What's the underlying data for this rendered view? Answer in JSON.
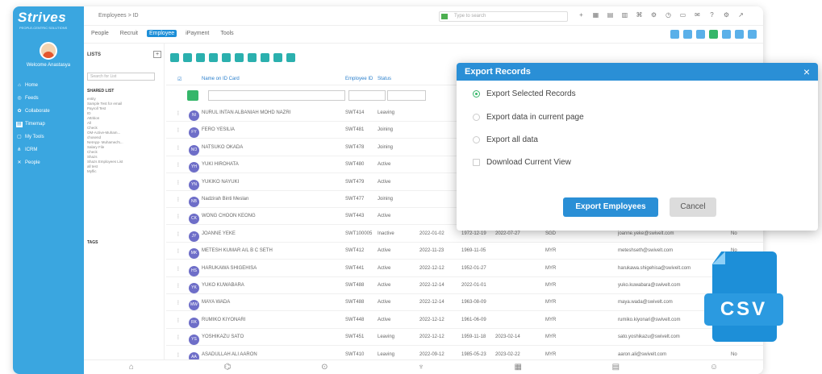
{
  "app": {
    "logo": "Strives",
    "tagline": "PEOPLE-CENTRIC SOLUTIONS",
    "breadcrumb": "Employees > ID",
    "welcome": "Welcome Anastasya"
  },
  "search": {
    "placeholder": "Type to search"
  },
  "nav": [
    {
      "label": "Home",
      "icon": "home-icon"
    },
    {
      "label": "Feeds",
      "icon": "feeds-icon"
    },
    {
      "label": "Collaborate",
      "icon": "collaborate-icon"
    },
    {
      "label": "Timemap",
      "icon": "timemap-icon"
    },
    {
      "label": "My Tools",
      "icon": "tools-icon"
    },
    {
      "label": "ICRM",
      "icon": "crm-icon"
    },
    {
      "label": "People",
      "icon": "people-icon"
    }
  ],
  "menu": [
    "People",
    "Recruit",
    "Employee",
    "iPayment",
    "Tools"
  ],
  "lists": {
    "title": "LISTS",
    "search_placeholder": "Search for List",
    "shared": "SHARED LIST",
    "tags": "TAGS",
    "items": [
      "entity",
      "Sample Test for email",
      "Payroll Test",
      "ID",
      "Attrition",
      "All",
      "Check",
      "OM-Active-Muham...",
      "chosend",
      "NetApp- Muhamed's...",
      "Salary File",
      "Check",
      "Shazs",
      "Shazs Employees List",
      "all test",
      "Myflic"
    ]
  },
  "grid": {
    "headers": [
      "Name on ID Card",
      "Employee ID",
      "Status"
    ],
    "rows": [
      {
        "initials": "NI",
        "name": "NURUL INTAN ALBANIAH MOHD NAZRI",
        "id": "SWT414",
        "status": "Leaving",
        "d1": "",
        "d2": "",
        "d3": "",
        "cc": "",
        "email": "",
        "x": ""
      },
      {
        "initials": "FY",
        "name": "FERO YESILIA",
        "id": "SWT481",
        "status": "Joining",
        "d1": "",
        "d2": "",
        "d3": "",
        "cc": "",
        "email": "",
        "x": ""
      },
      {
        "initials": "NO",
        "name": "NATSUKO OKADA",
        "id": "SWT478",
        "status": "Joining",
        "d1": "",
        "d2": "",
        "d3": "",
        "cc": "",
        "email": "",
        "x": ""
      },
      {
        "initials": "YH",
        "name": "YUKI HIROHATA",
        "id": "SWT480",
        "status": "Active",
        "d1": "",
        "d2": "",
        "d3": "",
        "cc": "",
        "email": "",
        "x": ""
      },
      {
        "initials": "YN",
        "name": "YUKIKO NAYUKI",
        "id": "SWT479",
        "status": "Active",
        "d1": "",
        "d2": "",
        "d3": "",
        "cc": "",
        "email": "",
        "x": ""
      },
      {
        "initials": "NB",
        "name": "Nadzirah Binti Meslan",
        "id": "SWT477",
        "status": "Joining",
        "d1": "",
        "d2": "",
        "d3": "",
        "cc": "",
        "email": "",
        "x": ""
      },
      {
        "initials": "CK",
        "name": "WONG CHOON KEONG",
        "id": "SWT443",
        "status": "Active",
        "d1": "",
        "d2": "",
        "d3": "",
        "cc": "",
        "email": "",
        "x": ""
      },
      {
        "initials": "JY",
        "name": "JOANNE YEKE",
        "id": "SWT100005",
        "status": "Inactive",
        "d1": "2022-01-02",
        "d2": "1972-12-19",
        "d3": "2022-07-27",
        "cc": "SGD",
        "email": "joanne.yeke@swivelt.com",
        "x": "No"
      },
      {
        "initials": "MK",
        "name": "METESH KUMAR A/L B C SETH",
        "id": "SWT412",
        "status": "Active",
        "d1": "2022-11-23",
        "d2": "1969-11-05",
        "d3": "",
        "cc": "MYR",
        "email": "meteshseth@swivelt.com",
        "x": "No"
      },
      {
        "initials": "HS",
        "name": "HARUKAWA SHIGEHISA",
        "id": "SWT441",
        "status": "Active",
        "d1": "2022-12-12",
        "d2": "1952-01-27",
        "d3": "",
        "cc": "MYR",
        "email": "harukawa.shigehisa@swivelt.com",
        "x": ""
      },
      {
        "initials": "YK",
        "name": "YUKO KUWABARA",
        "id": "SWT488",
        "status": "Active",
        "d1": "2022-12-14",
        "d2": "2022-01-01",
        "d3": "",
        "cc": "MYR",
        "email": "yuko.kuwabara@swivelt.com",
        "x": ""
      },
      {
        "initials": "MW",
        "name": "MAYA WADA",
        "id": "SWT488",
        "status": "Active",
        "d1": "2022-12-14",
        "d2": "1963-08-09",
        "d3": "",
        "cc": "MYR",
        "email": "maya.wada@swivelt.com",
        "x": ""
      },
      {
        "initials": "RK",
        "name": "RUMIKO KIYONARI",
        "id": "SWT448",
        "status": "Active",
        "d1": "2022-12-12",
        "d2": "1961-06-09",
        "d3": "",
        "cc": "MYR",
        "email": "rumiko.kiyonari@swivelt.com",
        "x": ""
      },
      {
        "initials": "YS",
        "name": "YOSHIKAZU SATO",
        "id": "SWT451",
        "status": "Leaving",
        "d1": "2022-12-12",
        "d2": "1959-11-18",
        "d3": "2023-02-14",
        "cc": "MYR",
        "email": "sato.yoshikazu@swivelt.com",
        "x": ""
      },
      {
        "initials": "AA",
        "name": "ASADULLAH ALI AARON",
        "id": "SWT410",
        "status": "Leaving",
        "d1": "2022-09-12",
        "d2": "1985-05-23",
        "d3": "2023-02-22",
        "cc": "MYR",
        "email": "aaron.ali@swivelt.com",
        "x": "No"
      }
    ]
  },
  "modal": {
    "title": "Export Records",
    "close": "×",
    "options": [
      "Export Selected Records",
      "Export data in current page",
      "Export all data"
    ],
    "checkbox": "Download Current View",
    "primary": "Export Employees",
    "secondary": "Cancel"
  },
  "badge": {
    "label": "CSV"
  },
  "colors": {
    "primary": "#2a8fd6",
    "sidebar": "#3aa6e0",
    "accent": "#35b66a"
  }
}
